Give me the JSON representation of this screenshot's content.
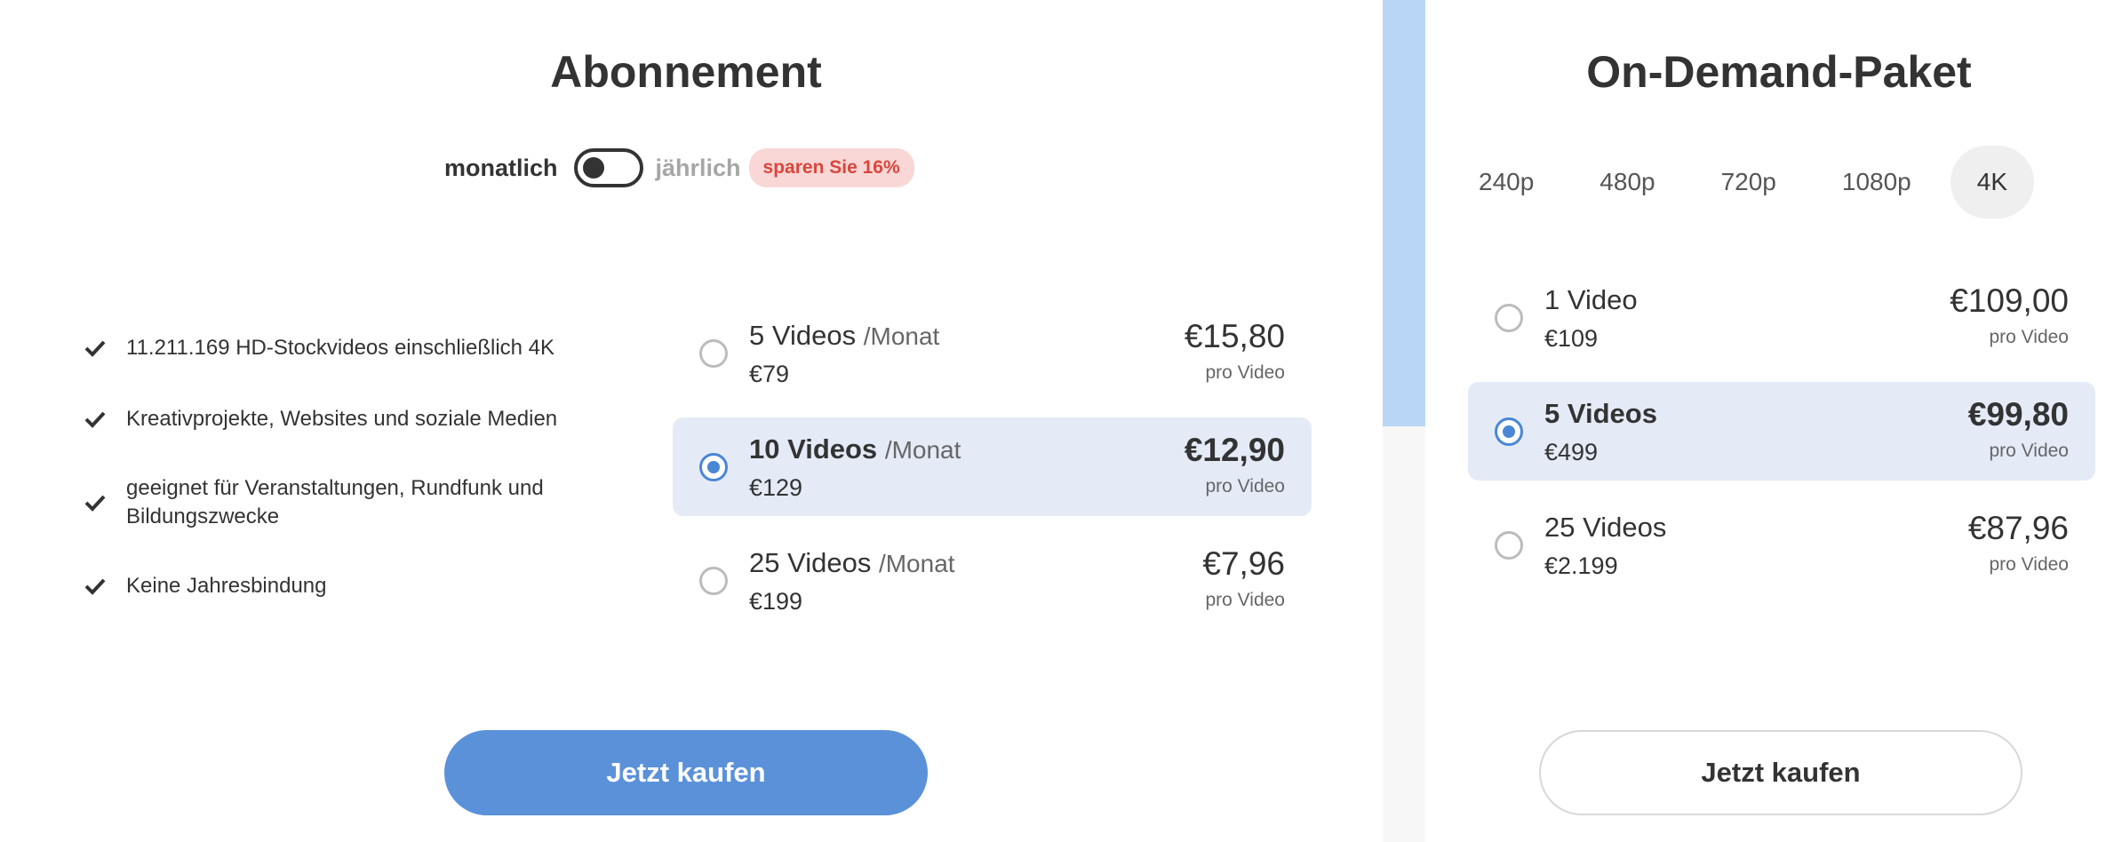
{
  "subscription": {
    "title": "Abonnement",
    "toggle": {
      "monthly_label": "monatlich",
      "yearly_label": "jährlich",
      "save_badge": "sparen Sie 16%",
      "selected": "monatlich"
    },
    "features": [
      "11.211.169 HD-Stockvideos einschließlich 4K",
      "Kreativprojekte, Websites und soziale Medien",
      "geeignet für Veranstaltungen, Rundfunk und Bildungszwecke",
      "Keine Jahresbindung"
    ],
    "plans": [
      {
        "quantity": "5 Videos",
        "period": "/Monat",
        "total": "€79",
        "price": "€15,80",
        "per": "pro Video",
        "selected": false
      },
      {
        "quantity": "10 Videos",
        "period": "/Monat",
        "total": "€129",
        "price": "€12,90",
        "per": "pro Video",
        "selected": true
      },
      {
        "quantity": "25 Videos",
        "period": "/Monat",
        "total": "€199",
        "price": "€7,96",
        "per": "pro Video",
        "selected": false
      }
    ],
    "buy_label": "Jetzt kaufen"
  },
  "on_demand": {
    "title": "On-Demand-Paket",
    "resolutions": [
      "240p",
      "480p",
      "720p",
      "1080p",
      "4K"
    ],
    "active_resolution": "4K",
    "plans": [
      {
        "quantity": "1 Video",
        "total": "€109",
        "price": "€109,00",
        "per": "pro Video",
        "selected": false
      },
      {
        "quantity": "5 Videos",
        "total": "€499",
        "price": "€99,80",
        "per": "pro Video",
        "selected": true
      },
      {
        "quantity": "25 Videos",
        "total": "€2.199",
        "price": "€87,96",
        "per": "pro Video",
        "selected": false
      }
    ],
    "buy_label": "Jetzt kaufen"
  },
  "colors": {
    "accent_blue": "#5a91d9",
    "selected_row": "#e4ebf7",
    "badge_bg": "#f8d7d6",
    "badge_text": "#d9463c",
    "divider_accent": "#b9d6f6"
  },
  "icons": {
    "feature_bullet": "check-icon",
    "plan_selector": "radio-icon"
  }
}
